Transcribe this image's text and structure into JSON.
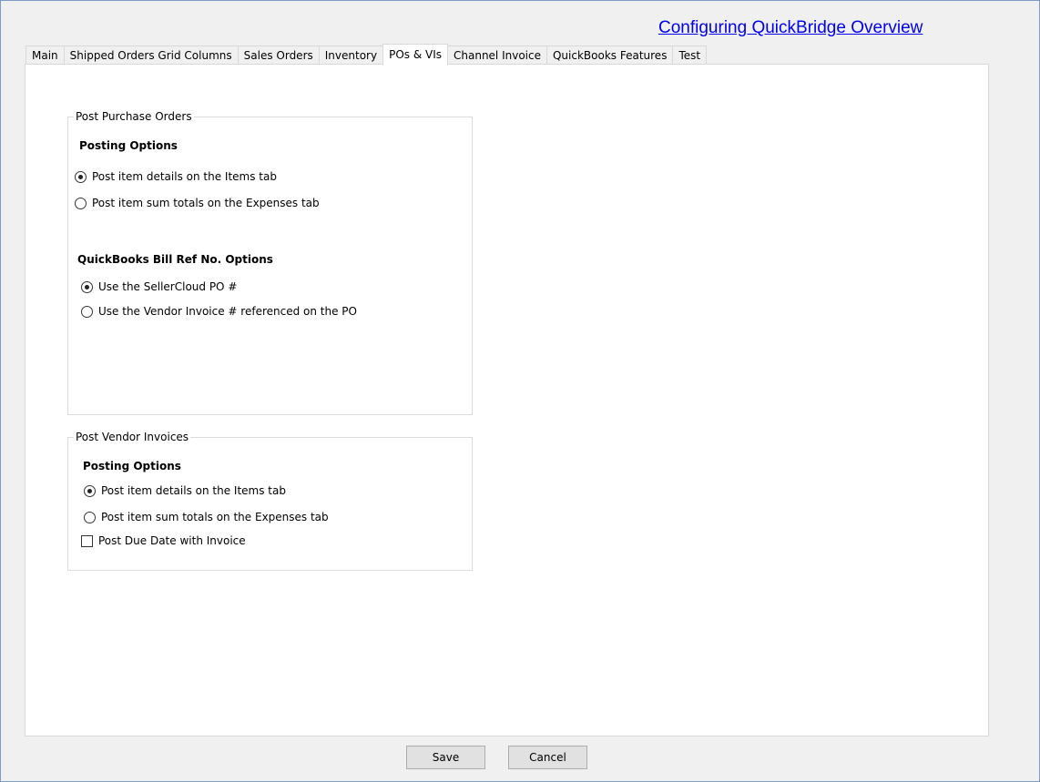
{
  "help_link": "Configuring QuickBridge Overview",
  "tabs": [
    {
      "label": "Main",
      "active": false
    },
    {
      "label": "Shipped Orders Grid Columns",
      "active": false
    },
    {
      "label": "Sales Orders",
      "active": false
    },
    {
      "label": "Inventory",
      "active": false
    },
    {
      "label": "POs & VIs",
      "active": true
    },
    {
      "label": "Channel Invoice",
      "active": false
    },
    {
      "label": "QuickBooks Features",
      "active": false
    },
    {
      "label": "Test",
      "active": false
    }
  ],
  "purchase_orders": {
    "legend": "Post Purchase Orders",
    "posting_heading": "Posting Options",
    "posting_options": [
      {
        "label": "Post item details on the Items tab",
        "checked": true
      },
      {
        "label": "Post item sum totals on the Expenses tab",
        "checked": false
      }
    ],
    "billref_heading": "QuickBooks Bill Ref No. Options",
    "billref_options": [
      {
        "label": "Use the SellerCloud PO #",
        "checked": true
      },
      {
        "label": "Use the Vendor Invoice # referenced on the PO",
        "checked": false
      }
    ]
  },
  "vendor_invoices": {
    "legend": "Post Vendor Invoices",
    "posting_heading": "Posting Options",
    "posting_options": [
      {
        "label": "Post item details on the Items tab",
        "checked": true
      },
      {
        "label": "Post item sum totals on the Expenses tab",
        "checked": false
      }
    ],
    "due_date_checkbox": {
      "label": "Post Due Date with Invoice",
      "checked": false
    }
  },
  "buttons": {
    "save": "Save",
    "cancel": "Cancel"
  }
}
